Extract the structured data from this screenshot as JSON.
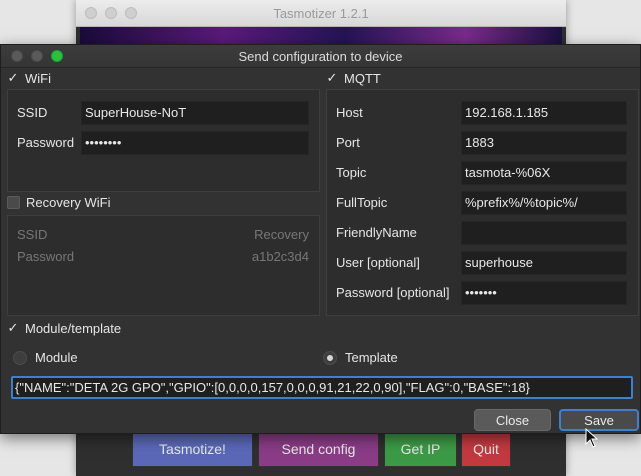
{
  "app_window": {
    "title": "Tasmotizer 1.2.1",
    "buttons": [
      {
        "label": "Tasmotize!",
        "color": "#5b68b8"
      },
      {
        "label": "Send config",
        "color": "#8a3c86"
      },
      {
        "label": "Get IP",
        "color": "#3c9a46"
      },
      {
        "label": "Quit",
        "color": "#c23a40"
      }
    ]
  },
  "dialog": {
    "title": "Send configuration to device",
    "wifi": {
      "header": "WiFi",
      "check": "✓",
      "ssid_label": "SSID",
      "ssid_value": "SuperHouse-NoT",
      "password_label": "Password",
      "password_value": "••••••••"
    },
    "recovery": {
      "header": "Recovery WiFi",
      "ssid_label": "SSID",
      "ssid_value": "Recovery",
      "password_label": "Password",
      "password_value": "a1b2c3d4"
    },
    "mqtt": {
      "header": "MQTT",
      "check": "✓",
      "host_label": "Host",
      "host_value": "192.168.1.185",
      "port_label": "Port",
      "port_value": "1883",
      "topic_label": "Topic",
      "topic_value": "tasmota-%06X",
      "fulltopic_label": "FullTopic",
      "fulltopic_value": "%prefix%/%topic%/",
      "friendlyname_label": "FriendlyName",
      "friendlyname_value": "",
      "user_label": "User [optional]",
      "user_value": "superhouse",
      "password_label": "Password [optional]",
      "password_value": "•••••••"
    },
    "module": {
      "header": "Module/template",
      "check": "✓",
      "module_label": "Module",
      "template_label": "Template",
      "template_value": "{\"NAME\":\"DETA 2G GPO\",\"GPIO\":[0,0,0,0,157,0,0,0,91,21,22,0,90],\"FLAG\":0,\"BASE\":18}"
    },
    "close_label": "Close",
    "save_label": "Save"
  }
}
